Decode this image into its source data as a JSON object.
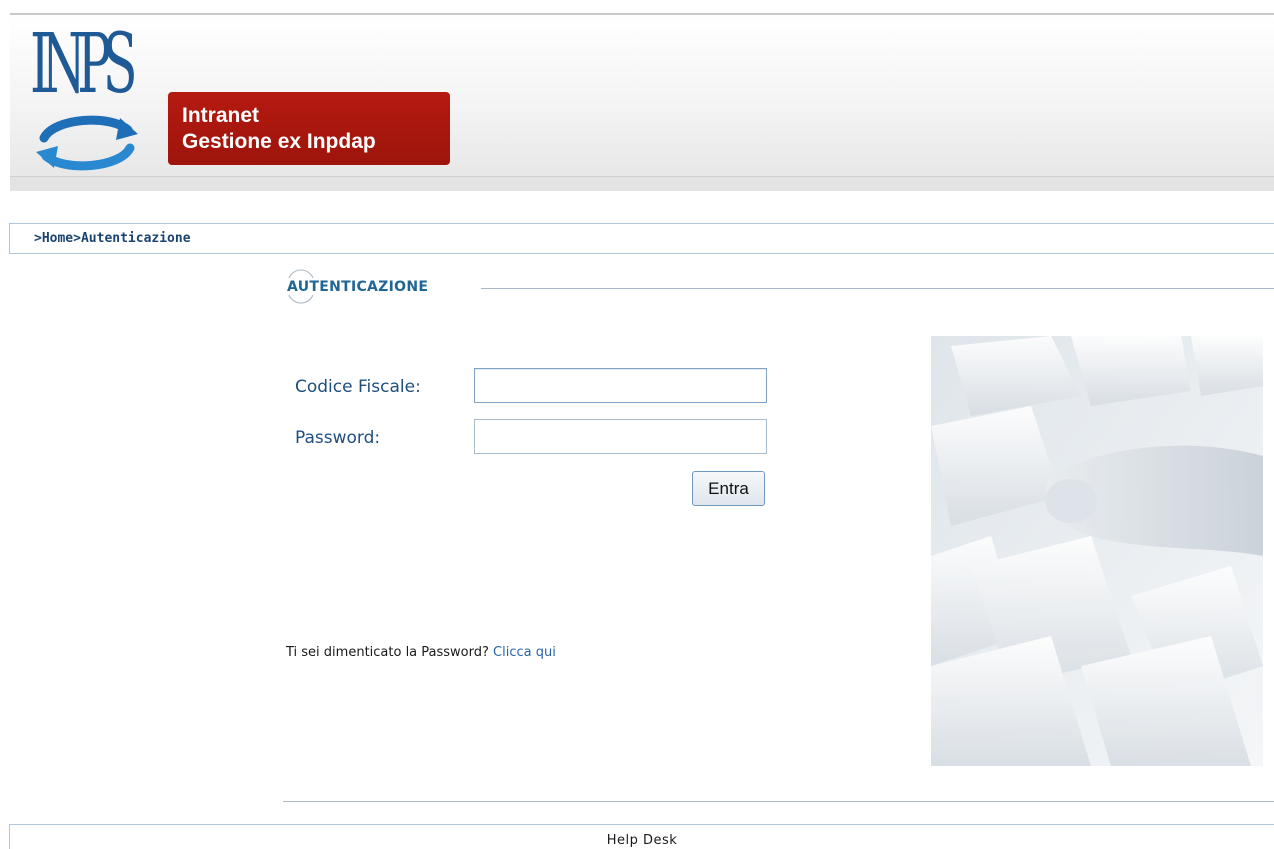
{
  "header": {
    "logo_text": "INPS",
    "badge_line1": "Intranet",
    "badge_line2": "Gestione ex Inpdap",
    "brand_color": "#1f5a96",
    "badge_color": "#a8160d"
  },
  "breadcrumb": {
    "text": ">Home>Autenticazione"
  },
  "section": {
    "title": "AUTENTICAZIONE"
  },
  "login_form": {
    "codice_fiscale_label": "Codice Fiscale:",
    "codice_fiscale_value": "",
    "password_label": "Password:",
    "password_value": "",
    "submit_label": "Entra"
  },
  "forgot": {
    "question": "Ti sei dimenticato la Password?",
    "link": "Clicca qui"
  },
  "footer": {
    "help_desk": "Help Desk"
  },
  "icons": {
    "logo_arrows": "circular-arrows-icon",
    "title_arc": "arc-ornament-icon",
    "photo": "keyboard-finger-photo"
  }
}
